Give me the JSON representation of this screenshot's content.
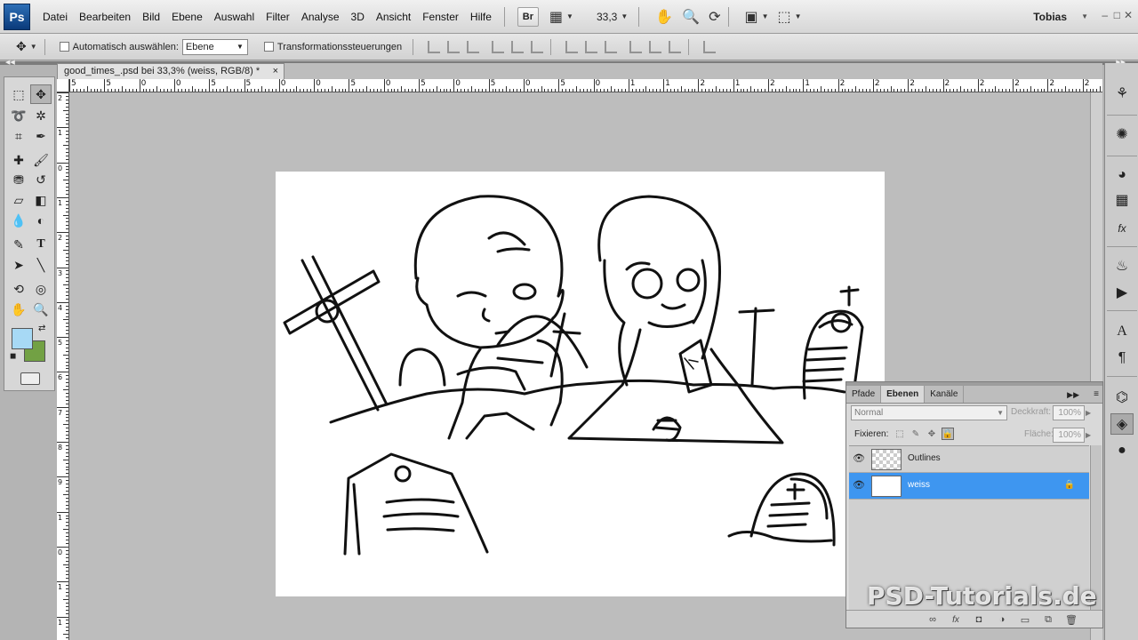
{
  "menubar": {
    "logo": "Ps",
    "items": [
      "Datei",
      "Bearbeiten",
      "Bild",
      "Ebene",
      "Auswahl",
      "Filter",
      "Analyse",
      "3D",
      "Ansicht",
      "Fenster",
      "Hilfe"
    ],
    "bridge_label": "Br",
    "zoom": "33,3",
    "user": "Tobias"
  },
  "options": {
    "auto_select_label": "Automatisch auswählen:",
    "auto_select_value": "Ebene",
    "transform_label": "Transformationssteuerungen"
  },
  "document": {
    "tab_title": "good_times_.psd bei 33,3% (weiss, RGB/8) *",
    "close": "×",
    "ruler_top": [
      "5",
      "5",
      "0",
      "0",
      "5",
      "5",
      "0",
      "0",
      "5",
      "0",
      "5",
      "0",
      "5",
      "0",
      "5",
      "0",
      "1",
      "1",
      "2",
      "1",
      "2",
      "1",
      "2",
      "2",
      "2",
      "2",
      "2",
      "2",
      "2",
      "2",
      "2",
      "23"
    ],
    "ruler_left": [
      "2",
      "1",
      "0",
      "1",
      "2",
      "3",
      "4",
      "5",
      "6",
      "7",
      "8",
      "9",
      "1",
      "0",
      "1",
      "1",
      "1"
    ]
  },
  "tools": {
    "fg_color": "#a7d9f5",
    "bg_color": "#72a144"
  },
  "layers_panel": {
    "tabs": [
      "Pfade",
      "Ebenen",
      "Kanäle"
    ],
    "active_tab": "Ebenen",
    "blend_mode": "Normal",
    "opacity_label": "Deckkraft:",
    "opacity_value": "100%",
    "lock_label": "Fixieren:",
    "fill_label": "Fläche:",
    "fill_value": "100%",
    "layers": [
      {
        "name": "Outlines",
        "selected": false,
        "locked": false
      },
      {
        "name": "weiss",
        "selected": true,
        "locked": true
      }
    ]
  },
  "watermark": "PSD-Tutorials.de"
}
